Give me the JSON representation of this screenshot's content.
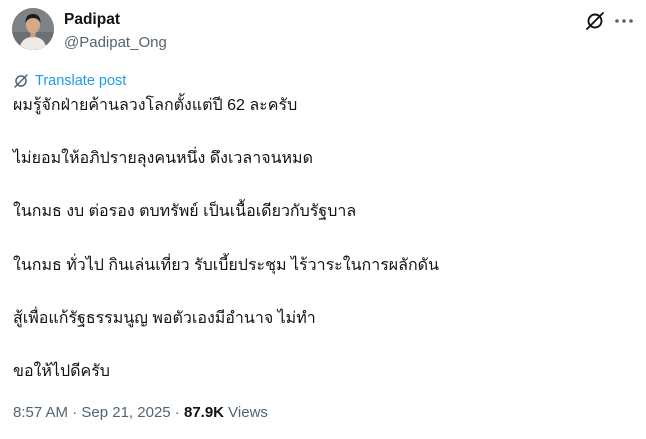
{
  "author": {
    "name": "Padipat",
    "handle": "@Padipat_Ong"
  },
  "icons": {
    "grok": "grok-icon",
    "more": "more-horizontal-icon",
    "translate": "translate-icon"
  },
  "translate_label": "Translate post",
  "body": {
    "lines": [
      "ผมรู้จักฝ่ายค้านลวงโลกตั้งแต่ปี 62 ละครับ",
      "ไม่ยอมให้อภิปรายลุงคนหนึ่ง ดึงเวลาจนหมด",
      "ในกมธ งบ ต่อรอง ตบทรัพย์ เป็นเนื้อเดียวกับรัฐบาล",
      "ในกมธ ทั่วไป กินเล่นเที่ยว รับเบี้ยประชุม ไร้วาระในการผลักดัน",
      "สู้เพื่อแก้รัฐธรรมนูญ พอตัวเองมีอำนาจ ไม่ทำ",
      "ขอให้ไปดีครับ"
    ]
  },
  "meta": {
    "time": "8:57 AM",
    "separator1": " · ",
    "date": "Sep 21, 2025",
    "separator2": " · ",
    "views_count": "87.9K",
    "views_label": " Views"
  },
  "colors": {
    "text": "#0f1419",
    "secondary": "#536471",
    "accent": "#1d9bf0"
  }
}
